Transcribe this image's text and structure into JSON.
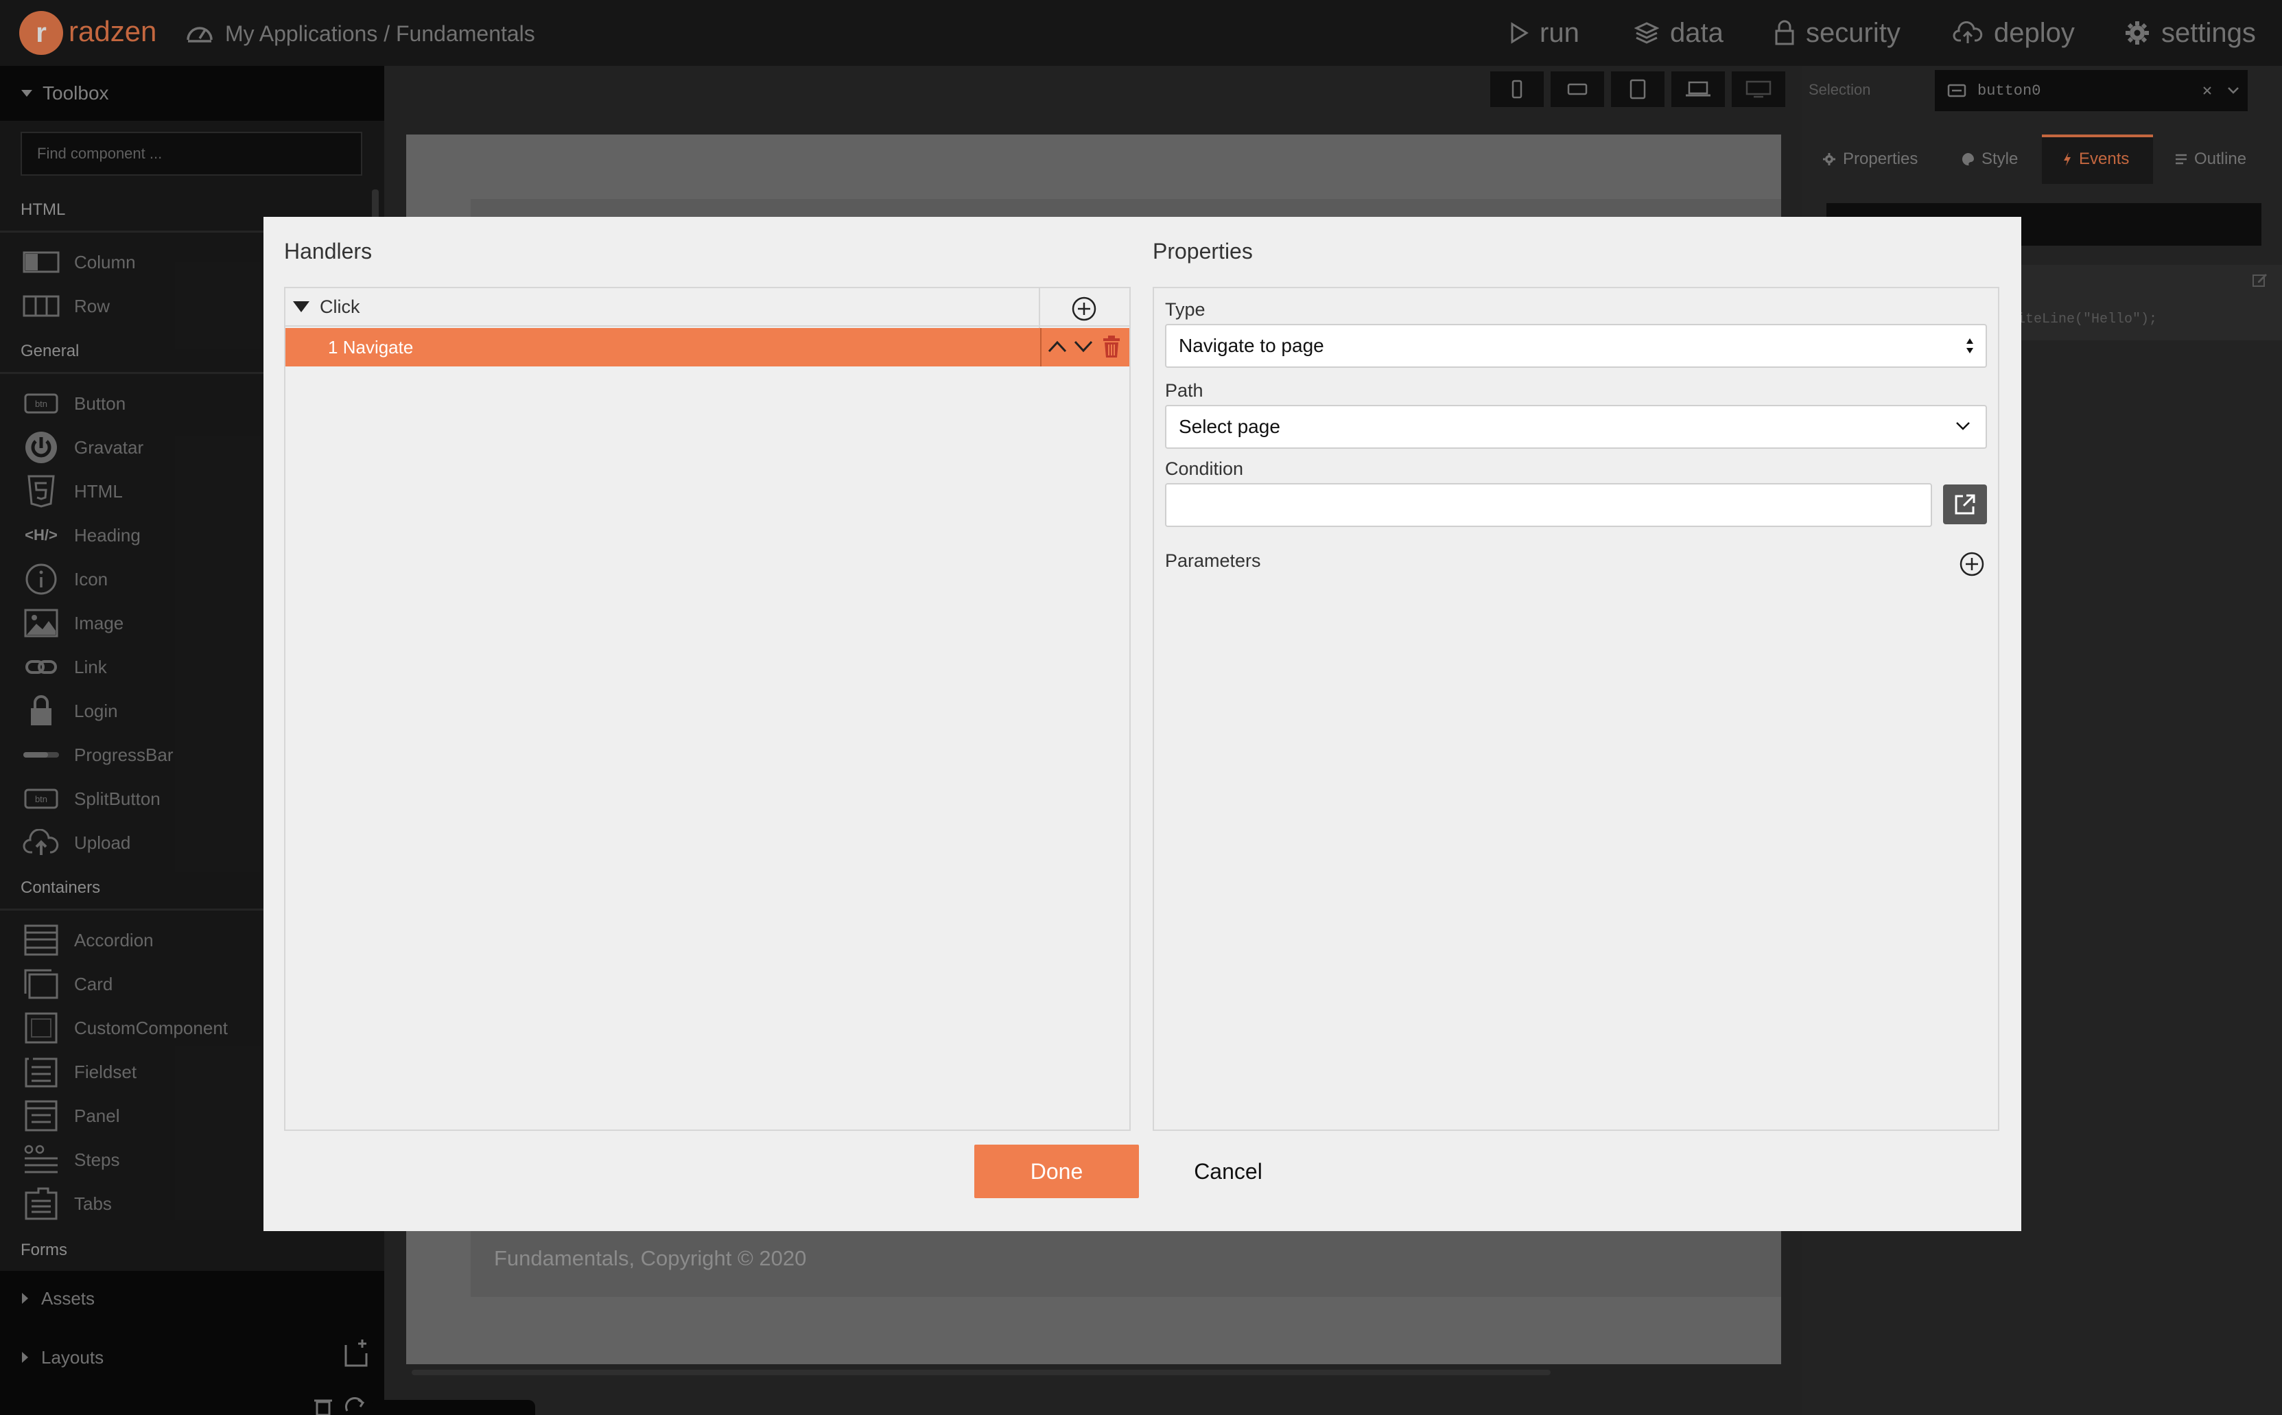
{
  "app": {
    "brand": "radzen",
    "logo_letter": "r",
    "breadcrumb": "My Applications / Fundamentals"
  },
  "topnav": {
    "run": "run",
    "data": "data",
    "security": "security",
    "deploy": "deploy",
    "settings": "settings"
  },
  "toolbox": {
    "title": "Toolbox",
    "search_placeholder": "Find component ...",
    "sections": {
      "html": "HTML",
      "general": "General",
      "containers": "Containers",
      "forms": "Forms"
    },
    "html_items": [
      "Column",
      "Row"
    ],
    "general_items": [
      "Button",
      "Gravatar",
      "HTML",
      "Heading",
      "Icon",
      "Image",
      "Link",
      "Login",
      "ProgressBar",
      "SplitButton",
      "Upload"
    ],
    "container_items": [
      "Accordion",
      "Card",
      "CustomComponent",
      "Fieldset",
      "Panel",
      "Steps",
      "Tabs"
    ],
    "assets": "Assets",
    "layouts": "Layouts",
    "icon_btn_label": "btn"
  },
  "canvas": {
    "footer_text": "Fundamentals, Copyright © 2020"
  },
  "right_panel": {
    "selection_label": "Selection",
    "selection_value": "button0",
    "tabs": {
      "properties": "Properties",
      "style": "Style",
      "events": "Events",
      "outline": "Outline"
    },
    "code_snippet": "iteLine(\"Hello\");"
  },
  "modal": {
    "handlers_title": "Handlers",
    "properties_title": "Properties",
    "event_name": "Click",
    "handler_index": "1",
    "handler_name": "Navigate",
    "type_label": "Type",
    "type_value": "Navigate to page",
    "path_label": "Path",
    "path_value": "Select page",
    "condition_label": "Condition",
    "condition_value": "",
    "parameters_label": "Parameters",
    "done_label": "Done",
    "cancel_label": "Cancel"
  },
  "colors": {
    "accent": "#f07e4e",
    "topbar_bg": "#1c1c1c",
    "modal_bg": "#efefef"
  }
}
